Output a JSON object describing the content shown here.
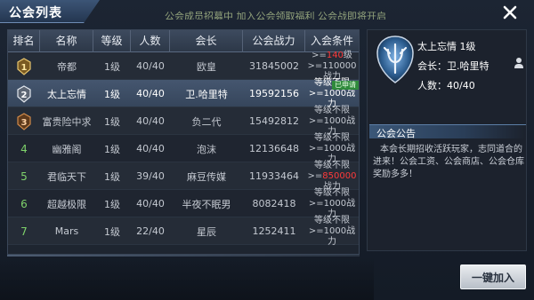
{
  "window": {
    "title": "公会列表",
    "marquee": "公会成员招募中 加入公会领取福利 公会战即将开启",
    "close_label": "✕"
  },
  "table": {
    "headers": [
      "排名",
      "名称",
      "等级",
      "人数",
      "会长",
      "公会战力",
      "入会条件"
    ],
    "rows": [
      {
        "rank": "1",
        "name": "帝都",
        "level": "1级",
        "members": "40/40",
        "leader": "欧皇",
        "power": "31845002",
        "cond1a": ">=",
        "cond1b": "140",
        "cond1c": "级",
        "cond2": ">=110000战力",
        "badge_color": "#c8a24a"
      },
      {
        "rank": "2",
        "name": "太上忘情",
        "level": "1级",
        "members": "40/40",
        "leader": "卫.哈里特",
        "power": "19592156",
        "cond1": "等级不限",
        "cond2": ">=1000战力",
        "badge_color": "#cfd5dd",
        "tag": "已申请"
      },
      {
        "rank": "3",
        "name": "富贵险中求",
        "level": "1级",
        "members": "40/40",
        "leader": "负二代",
        "power": "15492812",
        "cond1": "等级不限",
        "cond2": ">=1000战力",
        "badge_color": "#b5773c"
      },
      {
        "rank": "4",
        "name": "幽雅阁",
        "level": "1级",
        "members": "40/40",
        "leader": "泡沫",
        "power": "12136648",
        "cond1": "等级不限",
        "cond2": ">=1000战力"
      },
      {
        "rank": "5",
        "name": "君临天下",
        "level": "1级",
        "members": "39/40",
        "leader": "麻豆传媒",
        "power": "11933464",
        "cond1": "等级不限",
        "cond2a": ">=",
        "cond2b": "850000",
        "cond2c": "战力"
      },
      {
        "rank": "6",
        "name": "超越极限",
        "level": "1级",
        "members": "40/40",
        "leader": "半夜不眠男",
        "power": "8082418",
        "cond1": "等级不限",
        "cond2": ">=1000战力"
      },
      {
        "rank": "7",
        "name": "Mars",
        "level": "1级",
        "members": "22/40",
        "leader": "星辰",
        "power": "1252411",
        "cond1": "等级不限",
        "cond2": ">=1000战力"
      }
    ]
  },
  "info": {
    "name": "太上忘情",
    "level": "1级",
    "leader_label": "会长：",
    "leader": "卫.哈里特",
    "members_label": "人数：",
    "members": "40/40",
    "notice_title": "公会公告",
    "notice_text": "本会长期招收活跃玩家，志同道合的进来！公会工资、公会商店、公会仓库奖励多多！"
  },
  "join_button": "一键加入",
  "colors": {
    "accent_red": "#ff3a3a",
    "rank_green": "#7fd36b",
    "selected_row": "#45566f"
  }
}
